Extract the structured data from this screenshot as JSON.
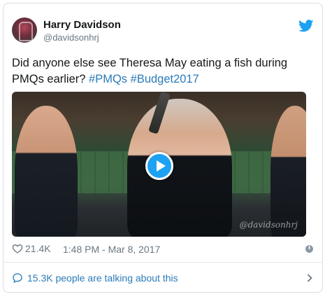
{
  "author": {
    "name": "Harry Davidson",
    "handle": "@davidsonhrj",
    "avatar_icon": "profile-photo"
  },
  "tweet": {
    "text_before": "Did anyone else see Theresa May eating a fish during PMQs earlier? ",
    "hashtags": [
      "#PMQs",
      "#Budget2017"
    ]
  },
  "media": {
    "watermark": "@davidsonhrj",
    "play_icon": "play-icon"
  },
  "meta": {
    "likes": "21.4K",
    "timestamp": "1:48 PM - Mar 8, 2017"
  },
  "footer": {
    "talking_text": "15.3K people are talking about this"
  },
  "colors": {
    "brand_blue": "#1da1f2",
    "link_blue": "#2b7bb9",
    "muted_gray": "#697882"
  }
}
